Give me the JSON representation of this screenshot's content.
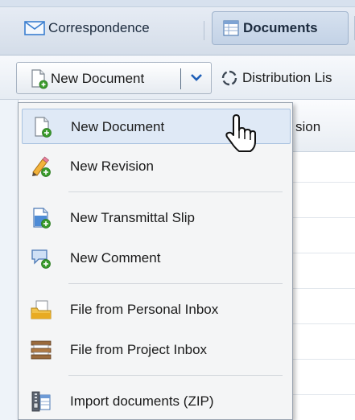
{
  "tabs": {
    "correspondence": "Correspondence",
    "documents": "Documents"
  },
  "toolbar": {
    "new_document": "New Document",
    "distribution_list": "Distribution Lis"
  },
  "grid": {
    "header_fragment": "sion"
  },
  "menu": {
    "items": [
      {
        "label": "New Document",
        "icon": "new-document-icon",
        "highlighted": true
      },
      {
        "label": "New Revision",
        "icon": "new-revision-icon"
      },
      {
        "label": "New Transmittal Slip",
        "icon": "new-transmittal-slip-icon"
      },
      {
        "label": "New Comment",
        "icon": "new-comment-icon"
      },
      {
        "label": "File from Personal Inbox",
        "icon": "personal-inbox-icon"
      },
      {
        "label": "File from Project Inbox",
        "icon": "project-inbox-icon"
      },
      {
        "label": "Import documents (ZIP)",
        "icon": "import-zip-icon"
      }
    ]
  },
  "colors": {
    "accent": "#2a6fc9",
    "highlight": "#dfe9f6",
    "add_green": "#3a9b2c"
  }
}
